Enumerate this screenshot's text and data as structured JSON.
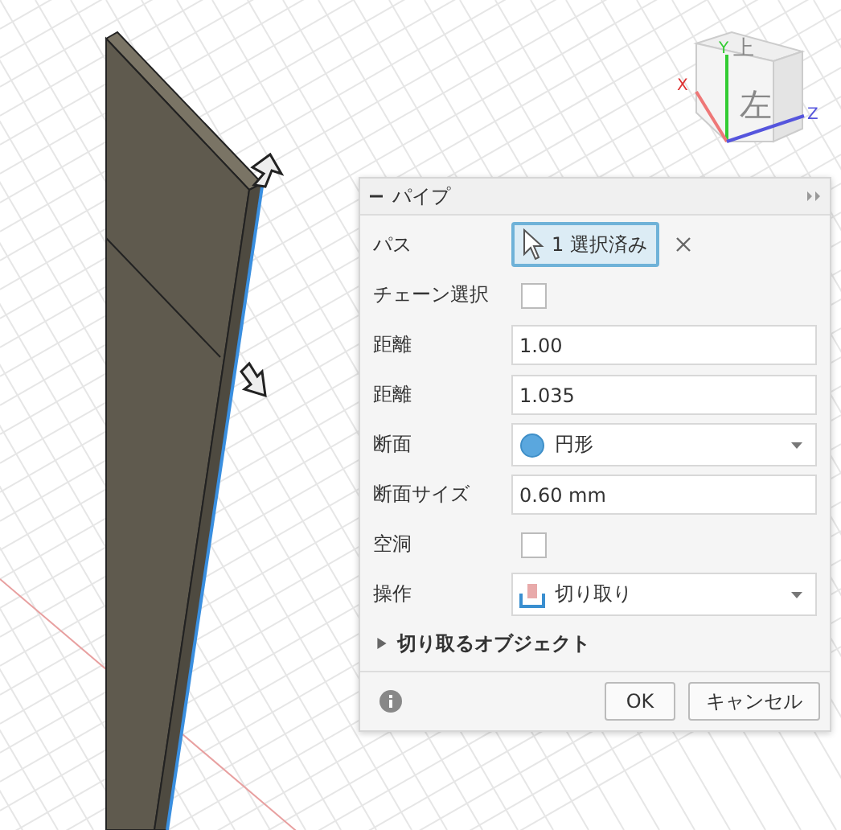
{
  "viewcube": {
    "top_label": "上",
    "front_label": "左",
    "axes": [
      "X",
      "Y",
      "Z"
    ]
  },
  "dialog": {
    "title": "パイプ",
    "expanded": true,
    "rows": [
      {
        "kind": "selection",
        "label": "パス",
        "value": "1 選択済み"
      },
      {
        "kind": "checkbox",
        "label": "チェーン選択",
        "checked": false
      },
      {
        "kind": "input",
        "label": "距離",
        "value": "1.00"
      },
      {
        "kind": "input",
        "label": "距離",
        "value": "1.035"
      },
      {
        "kind": "shape-dropdown",
        "label": "断面",
        "value": "円形"
      },
      {
        "kind": "input",
        "label": "断面サイズ",
        "value": "0.60 mm"
      },
      {
        "kind": "checkbox",
        "label": "空洞",
        "checked": false
      },
      {
        "kind": "operation-dropdown",
        "label": "操作",
        "value": "切り取り"
      }
    ],
    "section": {
      "label": "切り取るオブジェクト",
      "expanded": false
    },
    "buttons": [
      "OK",
      "キャンセル"
    ]
  }
}
